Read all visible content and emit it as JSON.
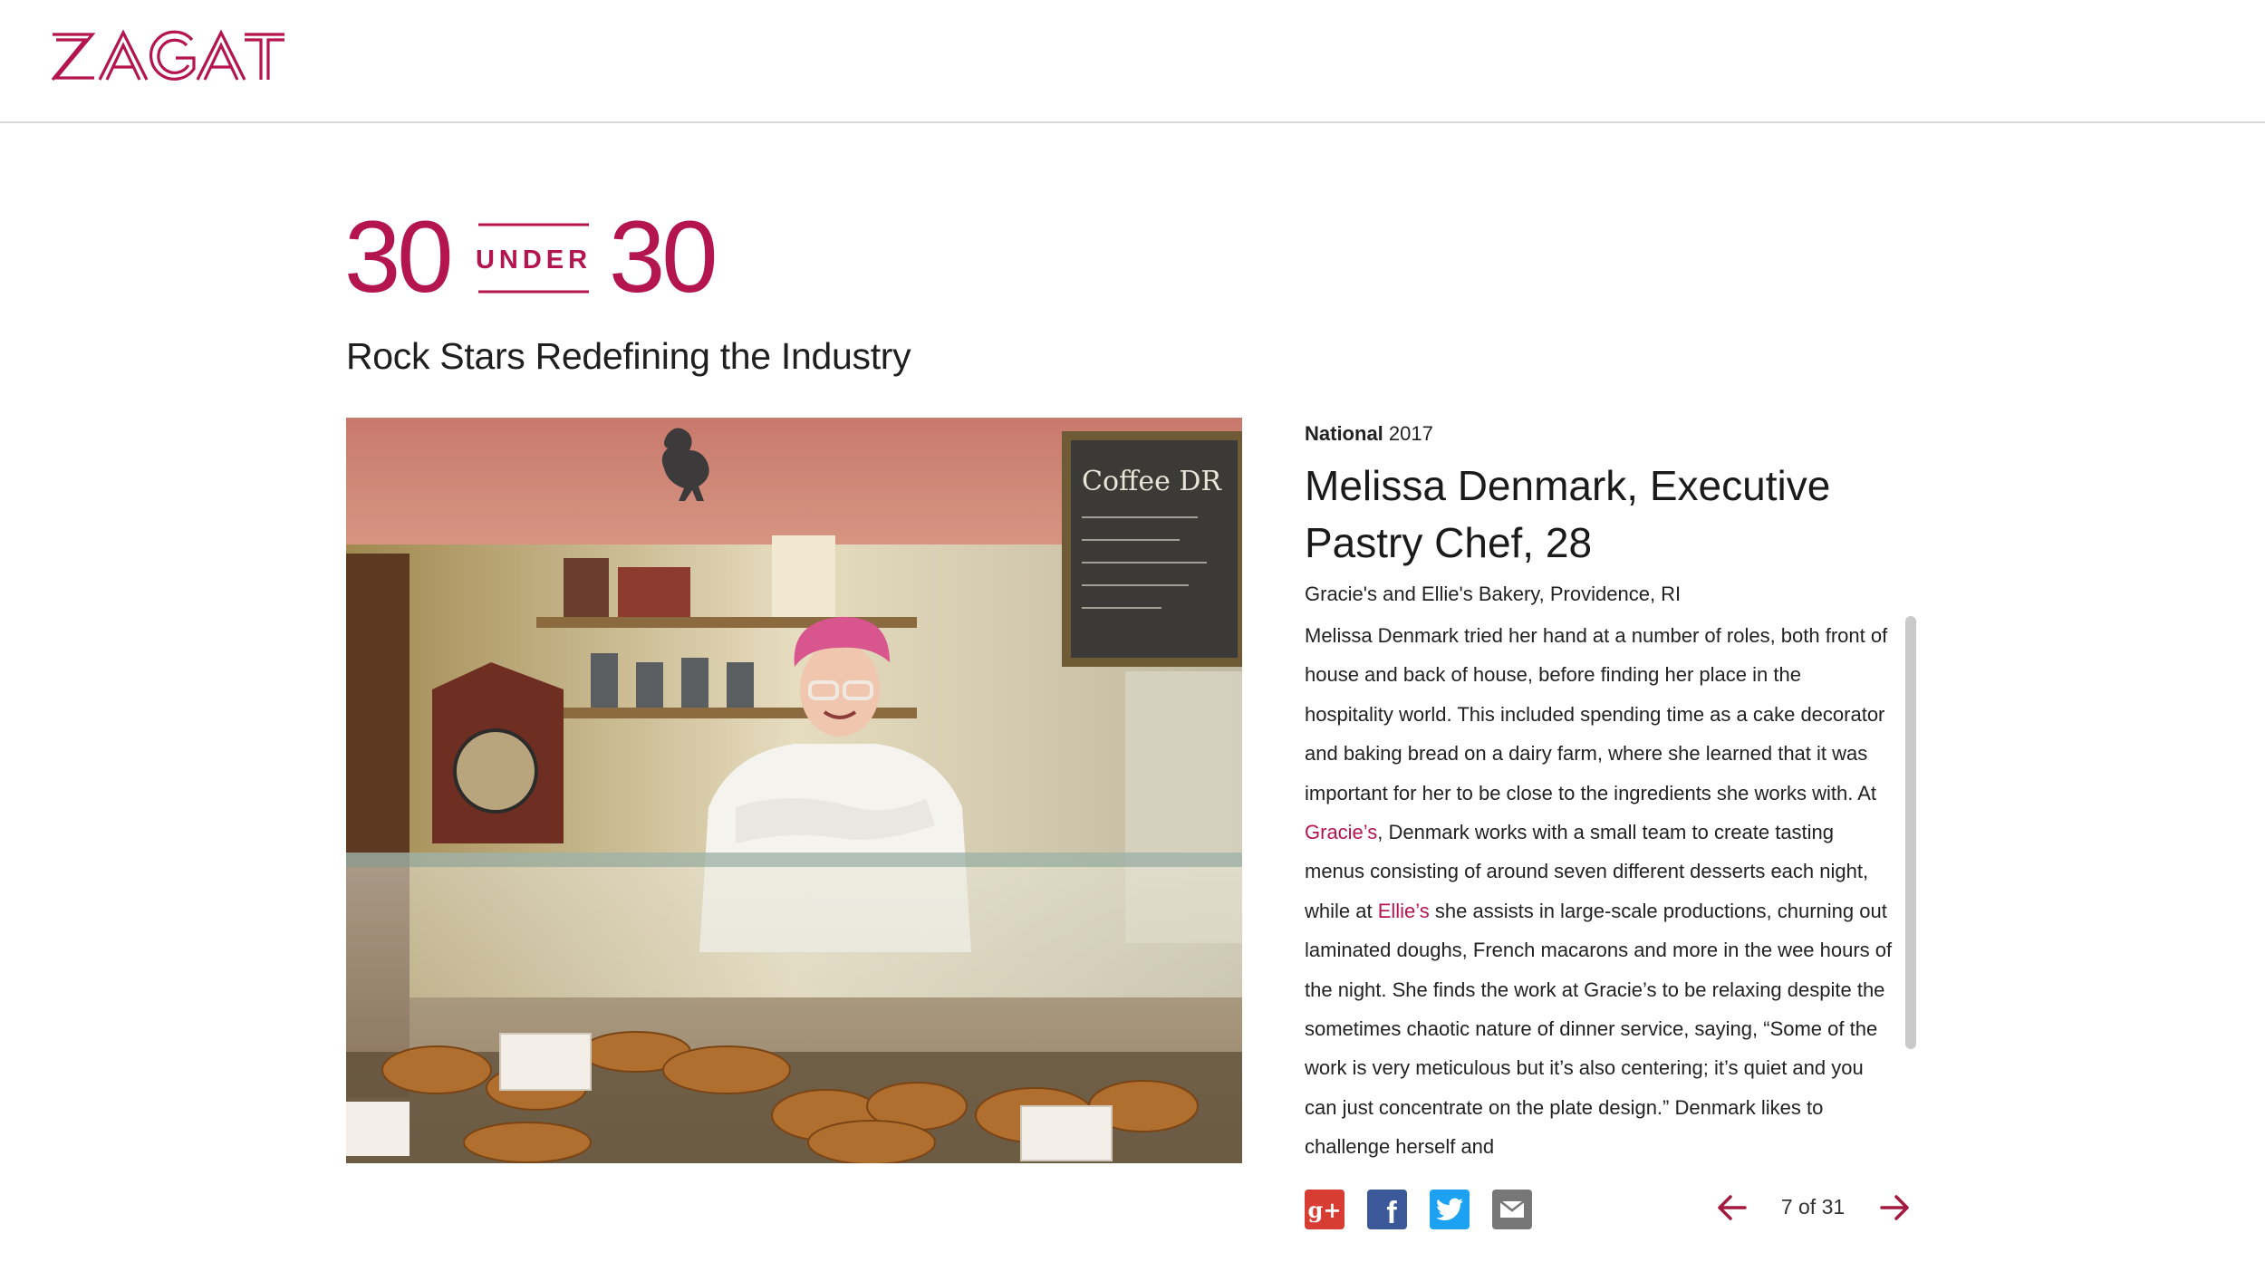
{
  "header": {
    "logo_text": "ZAGAT",
    "brand_color": "#b4154e"
  },
  "badge": {
    "left_number": "30",
    "middle_text": "UNDER",
    "right_number": "30"
  },
  "subtitle": "Rock Stars Redefining the Industry",
  "profile": {
    "region": "National",
    "year": "2017",
    "name": "Melissa Denmark, Executive Pastry Chef, 28",
    "venue": "Gracie's and Ellie's Bakery, Providence, RI",
    "bio": {
      "part1": "Melissa Denmark tried her hand at a number of roles, both front of house and back of house, before finding her place in the hospitality world. This included spending time as a cake decorator and baking bread on a dairy farm, where she learned that it was important for her to be close to the ingredients she works with. At ",
      "link1": "Gracie’s",
      "part2": ", Denmark works with a small team to create tasting menus consisting of around seven different desserts each night, while at ",
      "link2": "Ellie’s",
      "part3": " she assists in large-scale productions, churning out laminated doughs, French macarons and more in the wee hours of the night. She finds the work at Gracie’s to be relaxing despite the sometimes chaotic nature of dinner service, saying, “Some of the work is very meticulous but it’s also centering; it’s quiet and you can just concentrate on the plate design.” Denmark likes to challenge herself and"
    }
  },
  "social": {
    "icons": [
      "google-plus-icon",
      "facebook-icon",
      "twitter-icon",
      "email-icon"
    ],
    "gplus_glyph": "g+",
    "facebook_glyph": "f"
  },
  "pager": {
    "text": "7 of 31",
    "current": 7,
    "total": 31
  },
  "photo": {
    "chalkboard_text": "Coffee DR"
  }
}
